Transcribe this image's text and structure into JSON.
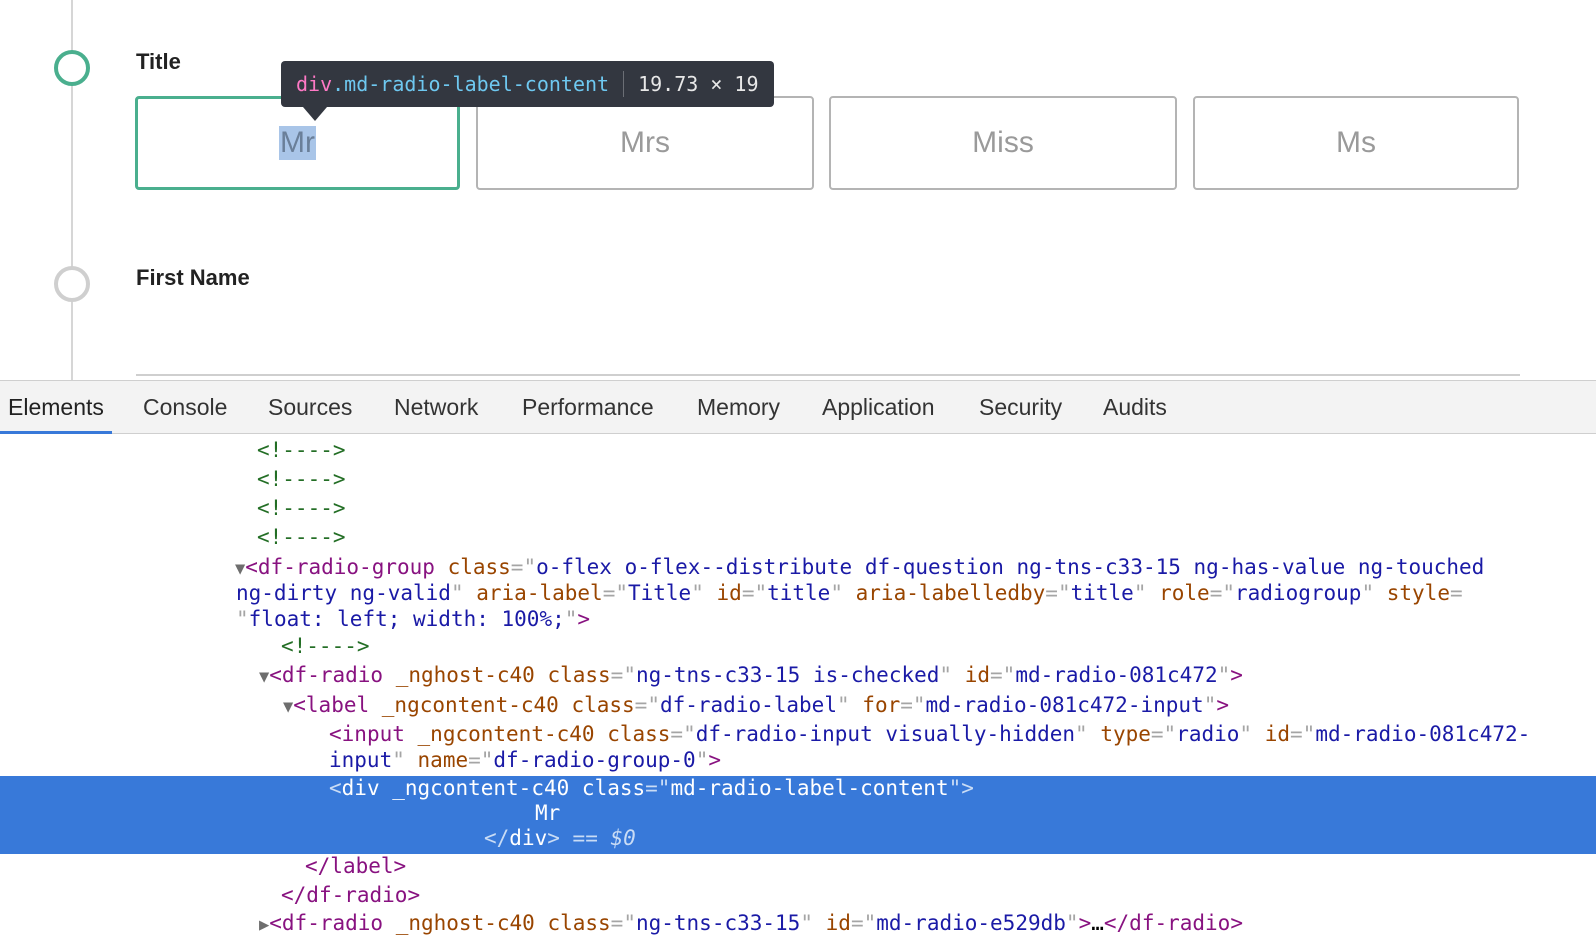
{
  "form": {
    "steps": [
      {
        "label": "Title",
        "state": "active"
      },
      {
        "label": "First Name",
        "state": "inactive"
      }
    ],
    "title_options": [
      {
        "label": "Mr",
        "checked": true
      },
      {
        "label": "Mrs",
        "checked": false
      },
      {
        "label": "Miss",
        "checked": false
      },
      {
        "label": "Ms",
        "checked": false
      }
    ],
    "accent_color": "#4aaf8e"
  },
  "tooltip": {
    "tag": "div",
    "class": ".md-radio-label-content",
    "dimensions": "19.73 × 19"
  },
  "devtools": {
    "tabs": [
      "Elements",
      "Console",
      "Sources",
      "Network",
      "Performance",
      "Memory",
      "Application",
      "Security",
      "Audits"
    ],
    "active_tab": "Elements",
    "comment": "<!---->",
    "dom": {
      "radio_group_tag": "df-radio-group",
      "radio_group_class": "o-flex o-flex--distribute df-question ng-tns-c33-15 ng-has-value ng-touched",
      "radio_group_class_cont": "ng-dirty ng-valid",
      "aria_label": "Title",
      "id_title": "title",
      "aria_labelledby": "title",
      "role": "radiogroup",
      "style": "float: left; width: 100%;",
      "radio_tag": "df-radio",
      "radio_ngh": "_nghost-c40",
      "radio_class": "ng-tns-c33-15 is-checked",
      "radio_id": "md-radio-081c472",
      "label_tag": "label",
      "ngc": "_ngcontent-c40",
      "label_class": "df-radio-label",
      "label_for": "md-radio-081c472-input",
      "input_tag": "input",
      "input_class": "df-radio-input visually-hidden",
      "input_type": "radio",
      "input_id_a": "md-radio-081c472-",
      "input_id_b": "input",
      "input_name": "df-radio-group-0",
      "div_tag": "div",
      "div_class": "md-radio-label-content",
      "div_text": "Mr",
      "selected_marker": "== $0",
      "next_radio_class": "ng-tns-c33-15",
      "next_radio_id": "md-radio-e529db"
    }
  }
}
